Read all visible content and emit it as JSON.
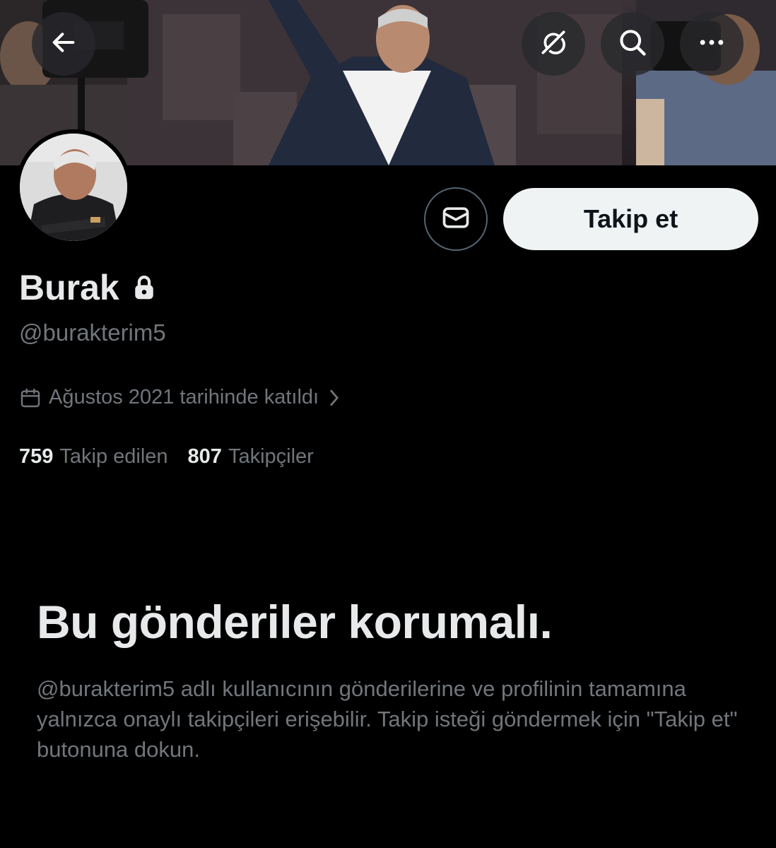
{
  "profile": {
    "display_name": "Burak",
    "handle": "@burakterim5",
    "joined": "Ağustos 2021 tarihinde katıldı",
    "following_count": "759",
    "following_label": "Takip edilen",
    "followers_count": "807",
    "followers_label": "Takipçiler"
  },
  "actions": {
    "follow_label": "Takip et"
  },
  "protected": {
    "title": "Bu gönderiler korumalı.",
    "description": "@burakterim5 adlı kullanıcının gönderilerine ve profilinin tamamına yalnızca onaylı takipçileri erişebilir. Takip isteği göndermek için \"Takip et\" butonuna dokun."
  },
  "icons": {
    "back": "arrow-left-icon",
    "grok": "grok-icon",
    "search": "search-icon",
    "more": "more-dots-icon",
    "message": "envelope-icon",
    "lock": "lock-icon",
    "calendar": "calendar-icon",
    "chevron": "chevron-right-icon"
  },
  "colors": {
    "background": "#000000",
    "primary_text": "#e7e9ea",
    "secondary_text": "#71767b",
    "follow_button_bg": "#eff3f4",
    "follow_button_text": "#0f1419"
  }
}
